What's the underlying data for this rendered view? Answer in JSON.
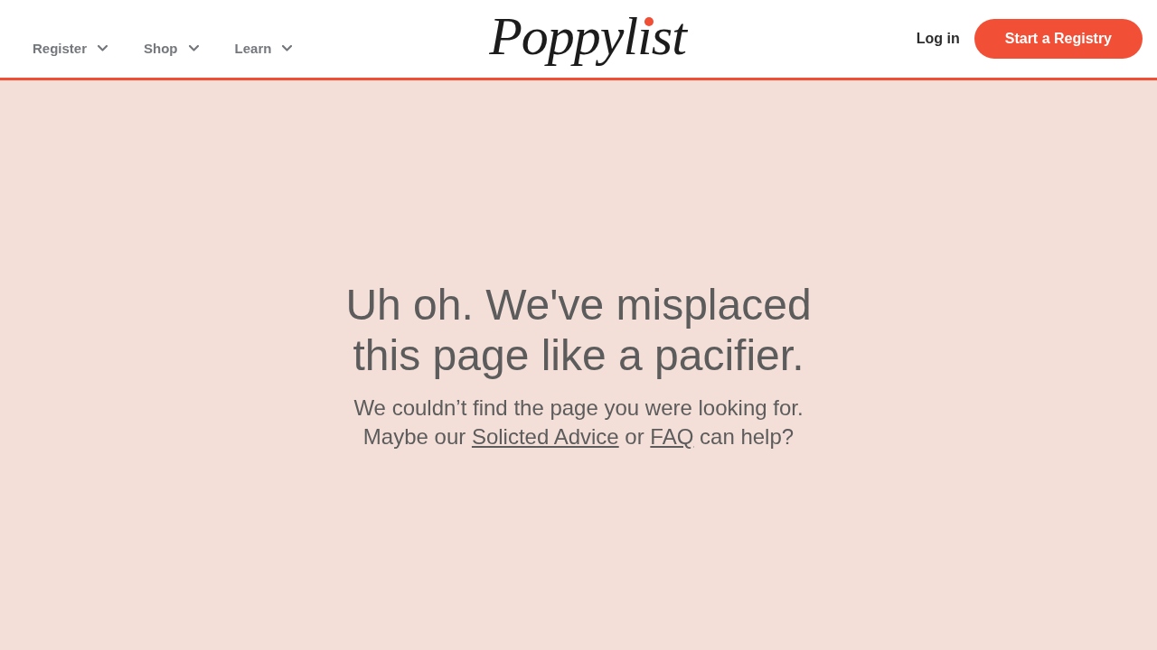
{
  "header": {
    "nav": [
      {
        "label": "Register"
      },
      {
        "label": "Shop"
      },
      {
        "label": "Learn"
      }
    ],
    "logo": "Poppylist",
    "login": "Log in",
    "cta": "Start a Registry"
  },
  "error": {
    "heading": "Uh oh. We've misplaced this page like a pacifier.",
    "message": [
      {
        "kind": "text",
        "text": "We couldn’t find the page you were looking for. Maybe our "
      },
      {
        "kind": "link",
        "text": "Solicted Advice"
      },
      {
        "kind": "text",
        "text": " or "
      },
      {
        "kind": "link",
        "text": "FAQ"
      },
      {
        "kind": "text",
        "text": " can help?"
      }
    ]
  }
}
